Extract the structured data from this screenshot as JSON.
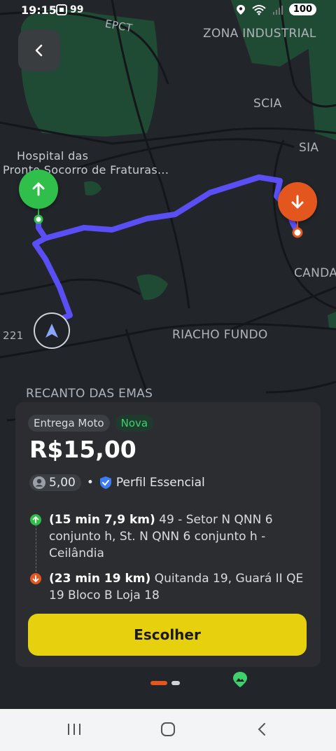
{
  "status_bar": {
    "time": "19:15",
    "notification_count": "99",
    "battery": "100"
  },
  "map": {
    "labels": {
      "epct": "EPCT",
      "zona_industrial": "ZONA INDUSTRIAL",
      "scia": "SCIA",
      "sia": "SIA",
      "hospital_line1": "Hospital das",
      "hospital_line2": "Pronto Socorro de Fraturas...",
      "canda": "CANDA",
      "riacho_fundo": "RIACHO FUNDO",
      "road_221": "221",
      "recanto_das_emas": "RECANTO DAS EMAS"
    },
    "colors": {
      "route": "#5a4ff5",
      "park": "#1f4a33",
      "origin": "#2fbf4a",
      "destination": "#e3571f"
    }
  },
  "offer": {
    "service_type": "Entrega Moto",
    "new_badge": "Nova",
    "price": "R$15,00",
    "rating": "5,00",
    "profile": "Perfil Essencial",
    "pickup": {
      "eta": "(15 min 7,9 km)",
      "address": "49 - Setor N QNN 6 conjunto h, St. N QNN 6 conjunto h - Ceilândia"
    },
    "dropoff": {
      "eta": "(23 min 19 km)",
      "address": "Quitanda 19, Guará II QE 19 Bloco B Loja 18"
    },
    "choose_label": "Escolher",
    "accent_color": "#e7d00d"
  },
  "pager": {
    "current": 1,
    "total": 2
  }
}
